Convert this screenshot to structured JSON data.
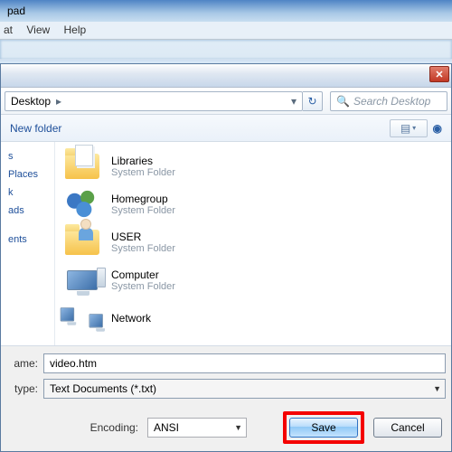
{
  "notepad": {
    "title_fragment": "pad",
    "menu": {
      "format": "at",
      "view": "View",
      "help": "Help"
    }
  },
  "dialog": {
    "breadcrumb": {
      "location": "Desktop"
    },
    "search_placeholder": "Search Desktop",
    "toolbar": {
      "new_folder": "New folder"
    },
    "sidebar": {
      "items": [
        {
          "label": "s"
        },
        {
          "label": "Places"
        },
        {
          "label": "k"
        },
        {
          "label": "ads"
        },
        {
          "label": "ents"
        }
      ]
    },
    "list": [
      {
        "name": "Libraries",
        "sub": "System Folder",
        "icon": "libraries"
      },
      {
        "name": "Homegroup",
        "sub": "System Folder",
        "icon": "homegroup"
      },
      {
        "name": "USER",
        "sub": "System Folder",
        "icon": "user"
      },
      {
        "name": "Computer",
        "sub": "System Folder",
        "icon": "computer"
      },
      {
        "name": "Network",
        "sub": "",
        "icon": "network"
      }
    ],
    "fields": {
      "filename_label": "ame:",
      "filename_value": "video.htm",
      "filetype_label": "type:",
      "filetype_value": "Text Documents (*.txt)",
      "encoding_label": "Encoding:",
      "encoding_value": "ANSI"
    },
    "buttons": {
      "save": "Save",
      "cancel": "Cancel"
    }
  }
}
